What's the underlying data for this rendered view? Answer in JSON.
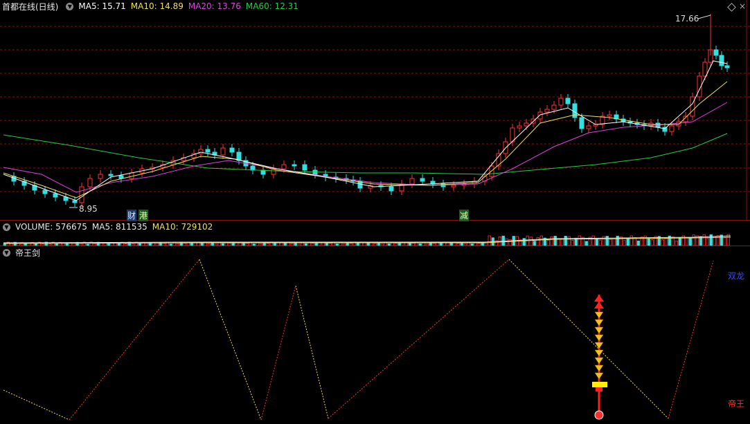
{
  "main_chart": {
    "title": "首都在线(日线)",
    "ma5": "MA5: 15.71",
    "ma10": "MA10: 14.89",
    "ma20": "MA20: 13.76",
    "ma60": "MA60: 12.31",
    "high_label": "17.66",
    "low_label": "8.95",
    "markers": [
      "财",
      "港",
      "减"
    ],
    "colors": {
      "ma5": "#ffffff",
      "ma10": "#f0e060",
      "ma20": "#e040e0",
      "ma60": "#20d040",
      "up": "#ff3333",
      "down": "#33e0e0",
      "grid": "#8a1010"
    }
  },
  "volume_panel": {
    "volume": "VOLUME: 576675",
    "ma5": "MA5: 811535",
    "ma10": "MA10: 729102"
  },
  "indicator_panel": {
    "title": "帝王剑",
    "label_top": "双龙",
    "label_bottom": "帝王"
  }
}
